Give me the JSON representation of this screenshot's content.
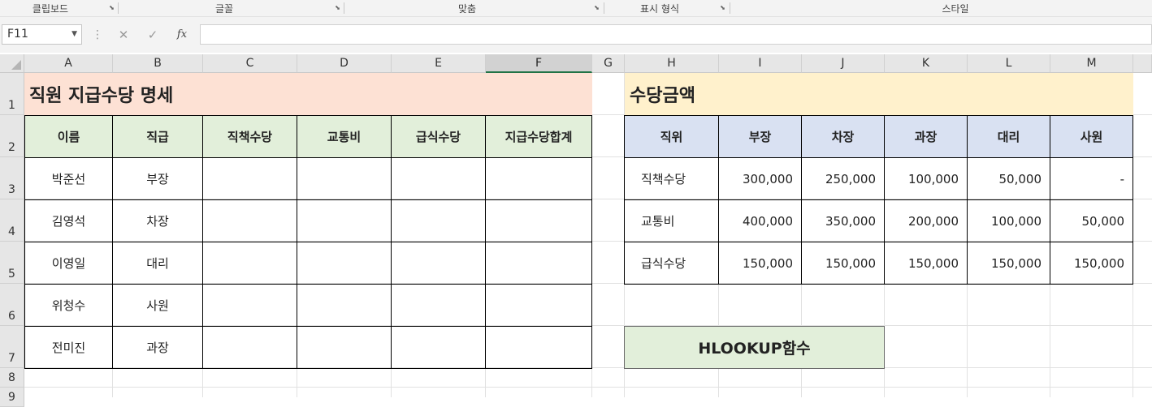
{
  "ribbon": {
    "groups": [
      "클립보드",
      "글꼴",
      "맞춤",
      "표시 형식",
      "스타일"
    ]
  },
  "formula_bar": {
    "name_box": "F11",
    "cancel_icon": "✕",
    "enter_icon": "✓",
    "fx_label": "fx",
    "formula": ""
  },
  "columns": [
    "A",
    "B",
    "C",
    "D",
    "E",
    "F",
    "G",
    "H",
    "I",
    "J",
    "K",
    "L",
    "M"
  ],
  "rows": [
    "1",
    "2",
    "3",
    "4",
    "5",
    "6",
    "7",
    "8",
    "9"
  ],
  "left_table": {
    "title": "직원 지급수당 명세",
    "headers": [
      "이름",
      "직급",
      "직책수당",
      "교통비",
      "급식수당",
      "지급수당합계"
    ],
    "rows": [
      [
        "박준선",
        "부장",
        "",
        "",
        "",
        ""
      ],
      [
        "김영석",
        "차장",
        "",
        "",
        "",
        ""
      ],
      [
        "이영일",
        "대리",
        "",
        "",
        "",
        ""
      ],
      [
        "위청수",
        "사원",
        "",
        "",
        "",
        ""
      ],
      [
        "전미진",
        "과장",
        "",
        "",
        "",
        ""
      ]
    ]
  },
  "right_table": {
    "title": "수당금액",
    "headers": [
      "직위",
      "부장",
      "차장",
      "과장",
      "대리",
      "사원"
    ],
    "rows": [
      [
        "직책수당",
        "300,000",
        "250,000",
        "100,000",
        "50,000",
        "-"
      ],
      [
        "교통비",
        "400,000",
        "350,000",
        "200,000",
        "100,000",
        "50,000"
      ],
      [
        "급식수당",
        "150,000",
        "150,000",
        "150,000",
        "150,000",
        "150,000"
      ]
    ]
  },
  "hlookup_label": "HLOOKUP함수",
  "colors": {
    "left_title_bg": "#fde1d4",
    "right_title_bg": "#fff1cc",
    "left_header_bg": "#e2efda",
    "right_header_bg": "#d9e1f2",
    "hlookup_bg": "#e2efda",
    "selection_accent": "#217346"
  }
}
